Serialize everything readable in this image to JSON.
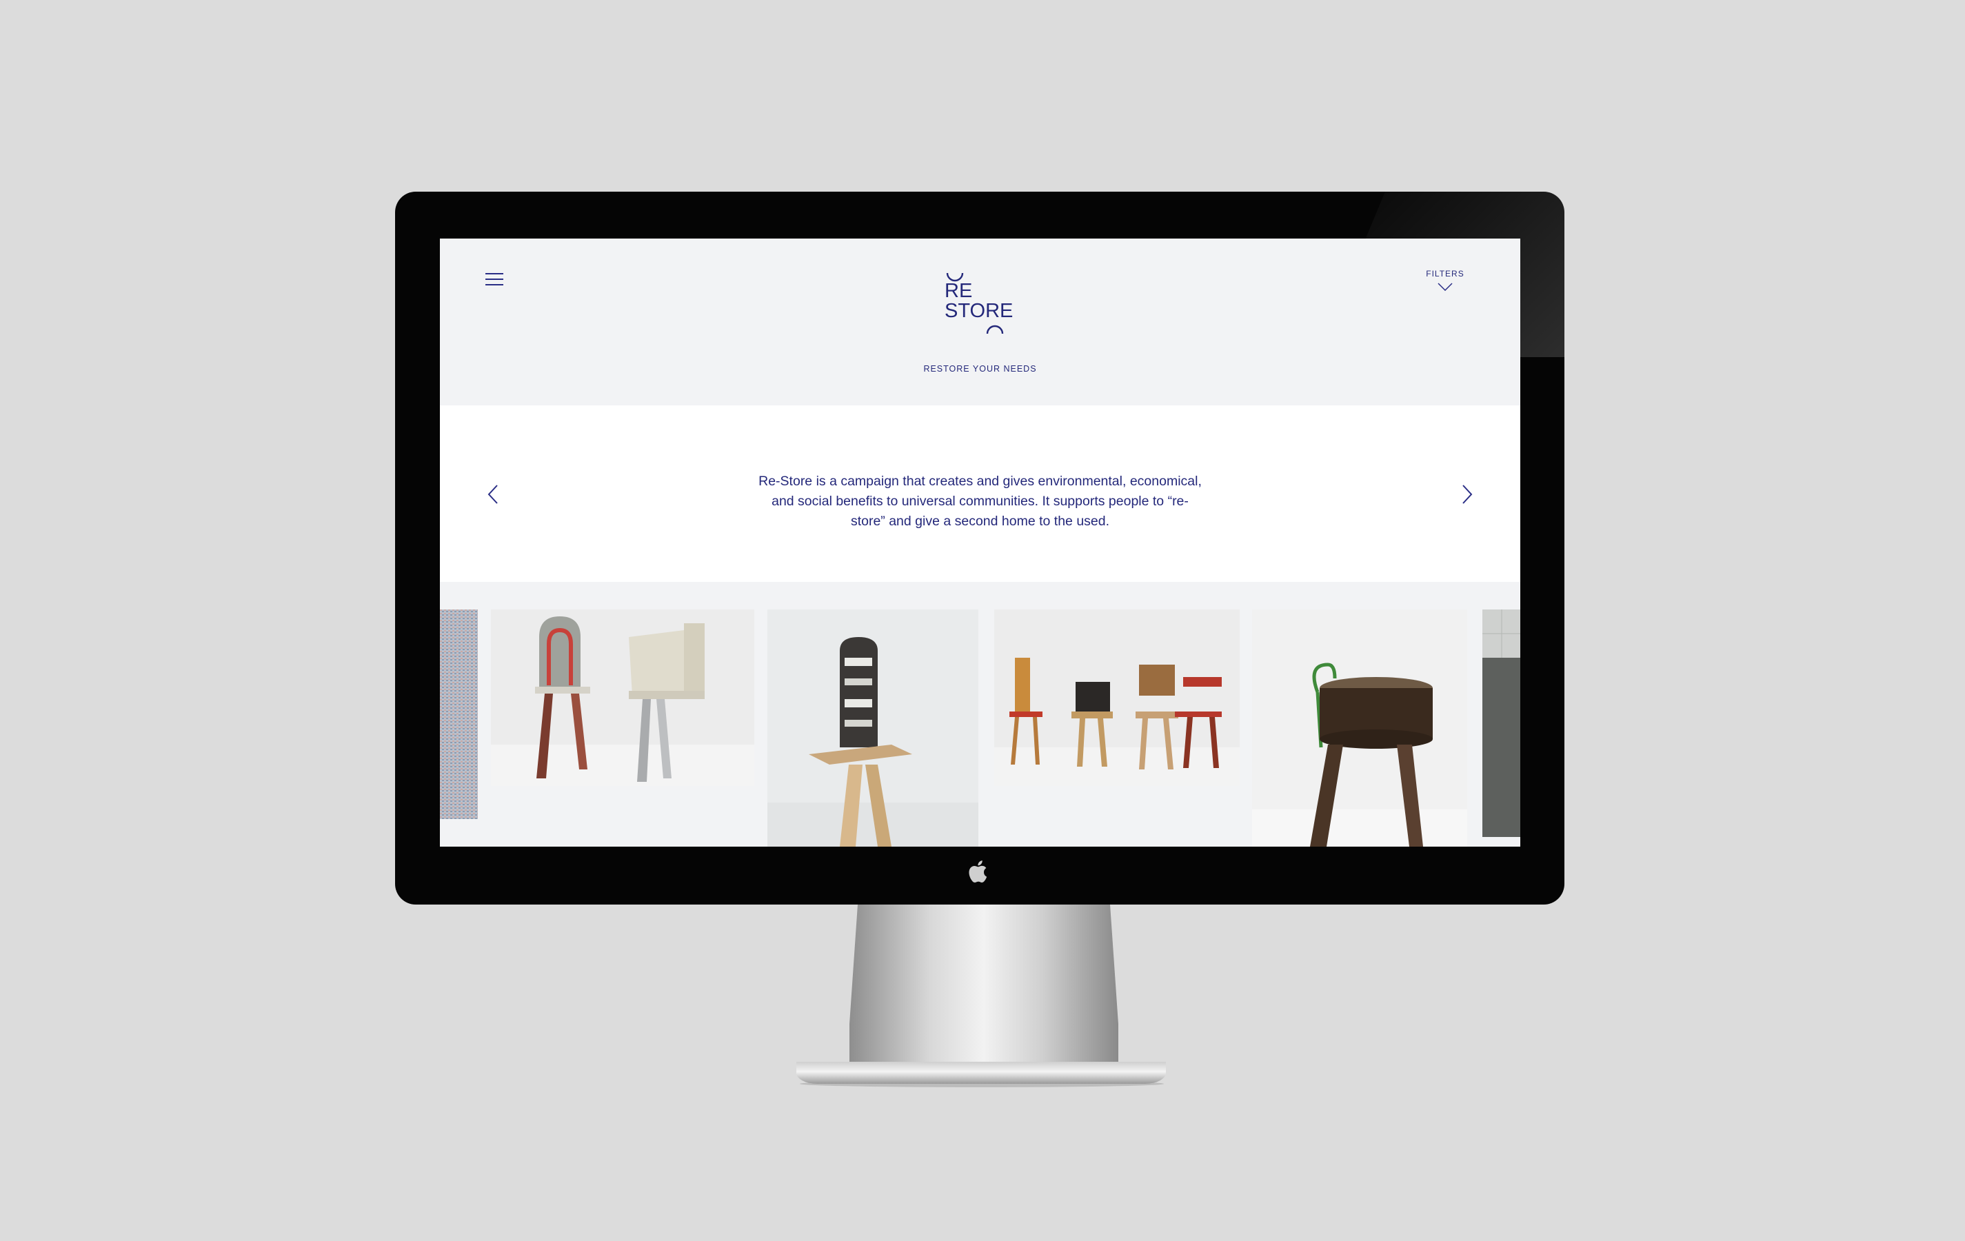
{
  "site": {
    "logo_text_line1": "RE",
    "logo_text_line2": "STORE",
    "tagline": "RESTORE YOUR NEEDS",
    "filters_label": "FILTERS",
    "menu_icon": "hamburger-icon",
    "filters_icon": "chevron-down-icon"
  },
  "intro": {
    "text": "Re-Store is a campaign that creates and gives environmental, economical, and social benefits to universal communities. It supports people to “re-store” and give a second home to the used.",
    "prev_icon": "chevron-left-icon",
    "next_icon": "chevron-right-icon"
  },
  "gallery": {
    "items": [
      {
        "subject": "partial fabric photo"
      },
      {
        "subject": "two chairs with metal legs"
      },
      {
        "subject": "skateboard chair on wooden legs"
      },
      {
        "subject": "four wooden chairs"
      },
      {
        "subject": "stump stool with green handle"
      },
      {
        "subject": "partial tiled wall photo"
      }
    ]
  },
  "colors": {
    "brand": "#24287a",
    "header_bg": "#f2f3f5",
    "intro_bg": "#ffffff",
    "page_bg": "#dcdcdc"
  }
}
